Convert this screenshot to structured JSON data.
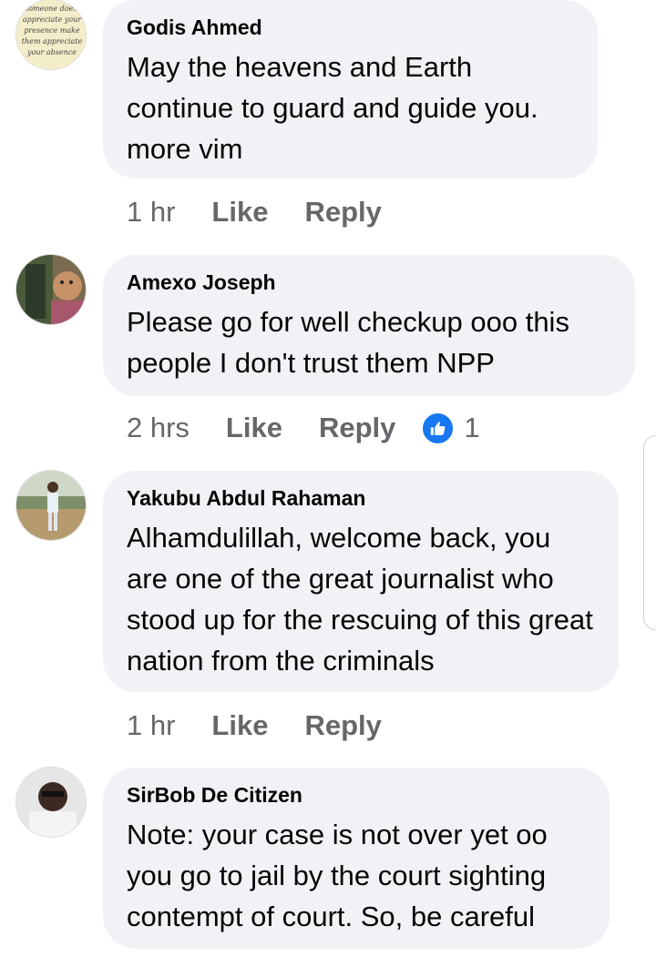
{
  "comments": [
    {
      "author": "Godis Ahmed",
      "text": "May the heavens and Earth continue to guard and guide you. more vim",
      "time": "1 hr",
      "like_label": "Like",
      "reply_label": "Reply",
      "avatar_text": [
        "if someone doesn't",
        "appreciate your",
        "presence make",
        "them appreciate",
        "your absence"
      ]
    },
    {
      "author": "Amexo Joseph",
      "text": "Please go for well checkup ooo this people I don't trust them NPP",
      "time": "2 hrs",
      "like_label": "Like",
      "reply_label": "Reply",
      "reaction_count": "1",
      "reaction_icon": "thumbs-up-icon",
      "reaction_color": "#1877f2"
    },
    {
      "author": "Yakubu Abdul Rahaman",
      "text": "Alhamdulillah, welcome back, you are one of the great journalist who stood up for the rescuing of this great nation from the criminals",
      "time": "1 hr",
      "like_label": "Like",
      "reply_label": "Reply"
    },
    {
      "author": "SirBob De Citizen",
      "text": "Note: your case is not over yet oo you go to jail by the court sighting contempt of court. So, be careful"
    }
  ],
  "colors": {
    "bubble": "#f0f2f5",
    "meta_text": "#65676b",
    "accent": "#1877f2"
  }
}
